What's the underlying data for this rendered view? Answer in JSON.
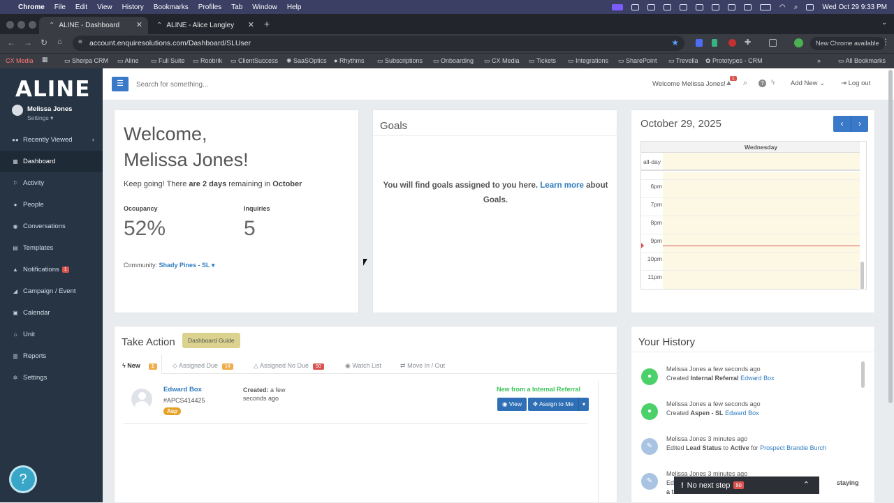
{
  "mac_menu": {
    "apple": "",
    "app": "Chrome",
    "items": [
      "File",
      "Edit",
      "View",
      "History",
      "Bookmarks",
      "Profiles",
      "Tab",
      "Window",
      "Help"
    ],
    "datetime": "Wed Oct 29  9:33 PM"
  },
  "tabs": [
    {
      "title": "ALINE - Dashboard",
      "active": true
    },
    {
      "title": "ALINE - Alice Langley",
      "active": false
    }
  ],
  "address": {
    "url": "account.enquiresolutions.com/Dashboard/SLUser",
    "update": "New Chrome available"
  },
  "bookmarks": [
    "CX Media",
    "Sherpa CRM",
    "Aline",
    "Full Suite",
    "Roobrik",
    "ClientSuccess",
    "SaaSOptics",
    "Rhythms",
    "Subscriptions",
    "Onboarding",
    "CX Media",
    "Tickets",
    "Integrations",
    "SharePoint",
    "Trevella",
    "Prototypes - CRM",
    "All Bookmarks"
  ],
  "sidebar": {
    "logo": "ALINE",
    "user": "Melissa Jones",
    "settings": "Settings",
    "items": [
      {
        "label": "Recently Viewed",
        "icon": "users-icon"
      },
      {
        "label": "Dashboard",
        "icon": "grid-icon",
        "active": true
      },
      {
        "label": "Activity",
        "icon": "activity-icon"
      },
      {
        "label": "People",
        "icon": "person-icon"
      },
      {
        "label": "Conversations",
        "icon": "chat-icon"
      },
      {
        "label": "Templates",
        "icon": "document-icon"
      },
      {
        "label": "Notifications",
        "icon": "bell-icon",
        "badge": "1"
      },
      {
        "label": "Campaign / Event",
        "icon": "megaphone-icon"
      },
      {
        "label": "Calendar",
        "icon": "calendar-icon"
      },
      {
        "label": "Unit",
        "icon": "home-icon"
      },
      {
        "label": "Reports",
        "icon": "chart-icon"
      },
      {
        "label": "Settings",
        "icon": "gear-icon"
      }
    ]
  },
  "topbar": {
    "search_placeholder": "Search for something...",
    "welcome": "Welcome Melissa Jones!",
    "notif_count": "1",
    "add_new": "Add New",
    "logout": "Log out"
  },
  "welcome": {
    "line1": "Welcome,",
    "line2": "Melissa Jones!",
    "keep_going_a": "Keep going! There ",
    "keep_going_b": "are 2 days",
    "keep_going_c": " remaining in ",
    "keep_going_d": "October",
    "occ_label": "Occupancy",
    "occ_value": "52%",
    "inq_label": "Inquiries",
    "inq_value": "5",
    "community_label": "Community:",
    "community_value": "Shady Pines - SL"
  },
  "goals": {
    "title": "Goals",
    "text_a": "You will find goals assigned to you here.",
    "link": "Learn more",
    "text_b": "about",
    "text_c": "Goals."
  },
  "calendar": {
    "date": "October 29, 2025",
    "day": "Wednesday",
    "allday": "all-day",
    "hours": [
      "6pm",
      "7pm",
      "8pm",
      "9pm",
      "10pm",
      "11pm"
    ]
  },
  "take_action": {
    "title": "Take Action",
    "guide": "Dashboard Guide",
    "tabs": [
      {
        "label": "New",
        "count": "1",
        "color": "#f0ad4e"
      },
      {
        "label": "Assigned Due",
        "count": "14",
        "color": "#f0ad4e"
      },
      {
        "label": "Assigned No Due",
        "count": "50",
        "color": "#d9534f"
      },
      {
        "label": "Watch List"
      },
      {
        "label": "Move In / Out"
      }
    ],
    "row": {
      "name": "Edward Box",
      "id": "#APCS414425",
      "tag": "Asp",
      "created_label": "Created:",
      "created_value": "a few",
      "created_value2": "seconds ago",
      "source": "New from a Internal Referral",
      "view": "View",
      "assign": "Assign to Me"
    }
  },
  "history": {
    "title": "Your History",
    "items": [
      {
        "who": "Melissa Jones",
        "when": "a few seconds ago",
        "pre": "Created ",
        "bold": "Internal Referral",
        "link": "Edward Box",
        "color": "#4cd16a"
      },
      {
        "who": "Melissa Jones",
        "when": "a few seconds ago",
        "pre": "Created ",
        "bold": "Aspen - SL",
        "link": "Edward Box",
        "color": "#4cd16a"
      },
      {
        "who": "Melissa Jones",
        "when": "3 minutes ago",
        "pre": "Edited ",
        "bold": "Lead Status",
        "mid": " to ",
        "bold2": "Active",
        "post": " for ",
        "link": "Prospect Brandie Burch",
        "color": "#a9c4e2"
      },
      {
        "who": "Melissa Jones",
        "when": "3 minutes ago",
        "pre": "Edi",
        "tail": "staying",
        "tail2": "a t",
        "color": "#a9c4e2"
      }
    ]
  },
  "next_step": {
    "label": "No next step",
    "count": "50"
  },
  "colors": {
    "sidebar": "#263444",
    "accent": "#3a78c8",
    "link": "#2f7bbf",
    "calendar_bg": "#fcf8e3",
    "now_line": "#d9534f"
  }
}
